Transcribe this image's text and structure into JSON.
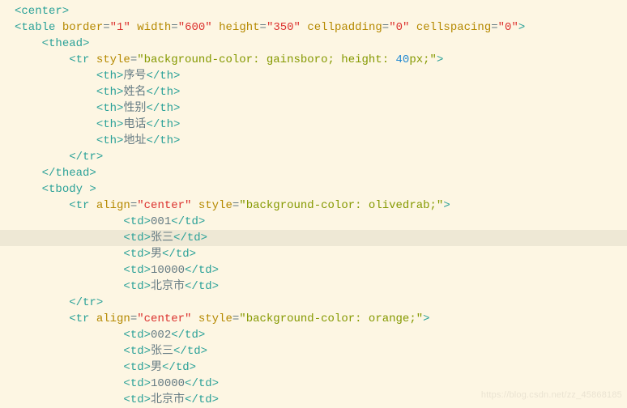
{
  "watermark": "https://blog.csdn.net/zz_45868185",
  "code_lines": [
    {
      "i": 0,
      "hl": false,
      "tokens": [
        {
          "t": "<center>",
          "c": "tag"
        }
      ]
    },
    {
      "i": 0,
      "hl": false,
      "tokens": [
        {
          "t": "<table ",
          "c": "tag"
        },
        {
          "t": "border",
          "c": "attr"
        },
        {
          "t": "=",
          "c": "text"
        },
        {
          "t": "\"1\"",
          "c": "val-red"
        },
        {
          "t": " ",
          "c": "text"
        },
        {
          "t": "width",
          "c": "attr"
        },
        {
          "t": "=",
          "c": "text"
        },
        {
          "t": "\"600\"",
          "c": "val-red"
        },
        {
          "t": " ",
          "c": "text"
        },
        {
          "t": "height",
          "c": "attr"
        },
        {
          "t": "=",
          "c": "text"
        },
        {
          "t": "\"350\"",
          "c": "val-red"
        },
        {
          "t": " ",
          "c": "text"
        },
        {
          "t": "cellpadding",
          "c": "attr"
        },
        {
          "t": "=",
          "c": "text"
        },
        {
          "t": "\"0\"",
          "c": "val-red"
        },
        {
          "t": " ",
          "c": "text"
        },
        {
          "t": "cellspacing",
          "c": "attr"
        },
        {
          "t": "=",
          "c": "text"
        },
        {
          "t": "\"0\"",
          "c": "val-red"
        },
        {
          "t": ">",
          "c": "tag"
        }
      ]
    },
    {
      "i": 4,
      "hl": false,
      "tokens": [
        {
          "t": "<thead>",
          "c": "tag"
        }
      ]
    },
    {
      "i": 8,
      "hl": false,
      "tokens": [
        {
          "t": "<tr ",
          "c": "tag"
        },
        {
          "t": "style",
          "c": "attr"
        },
        {
          "t": "=",
          "c": "text"
        },
        {
          "t": "\"background-color: gainsboro; height: ",
          "c": "val-olive"
        },
        {
          "t": "40",
          "c": "val-blue"
        },
        {
          "t": "px;\"",
          "c": "val-olive"
        },
        {
          "t": ">",
          "c": "tag"
        }
      ]
    },
    {
      "i": 12,
      "hl": false,
      "tokens": [
        {
          "t": "<th>",
          "c": "tag"
        },
        {
          "t": "序号",
          "c": "text"
        },
        {
          "t": "</th>",
          "c": "tag"
        }
      ]
    },
    {
      "i": 12,
      "hl": false,
      "tokens": [
        {
          "t": "<th>",
          "c": "tag"
        },
        {
          "t": "姓名",
          "c": "text"
        },
        {
          "t": "</th>",
          "c": "tag"
        }
      ]
    },
    {
      "i": 12,
      "hl": false,
      "tokens": [
        {
          "t": "<th>",
          "c": "tag"
        },
        {
          "t": "性别",
          "c": "text"
        },
        {
          "t": "</th>",
          "c": "tag"
        }
      ]
    },
    {
      "i": 12,
      "hl": false,
      "tokens": [
        {
          "t": "<th>",
          "c": "tag"
        },
        {
          "t": "电话",
          "c": "text"
        },
        {
          "t": "</th>",
          "c": "tag"
        }
      ]
    },
    {
      "i": 12,
      "hl": false,
      "tokens": [
        {
          "t": "<th>",
          "c": "tag"
        },
        {
          "t": "地址",
          "c": "text"
        },
        {
          "t": "</th>",
          "c": "tag"
        }
      ]
    },
    {
      "i": 8,
      "hl": false,
      "tokens": [
        {
          "t": "</tr>",
          "c": "tag"
        }
      ]
    },
    {
      "i": 4,
      "hl": false,
      "tokens": [
        {
          "t": "</thead>",
          "c": "tag"
        }
      ]
    },
    {
      "i": 4,
      "hl": false,
      "tokens": [
        {
          "t": "<tbody ",
          "c": "tag"
        },
        {
          "t": ">",
          "c": "tag"
        }
      ]
    },
    {
      "i": 8,
      "hl": false,
      "tokens": [
        {
          "t": "<tr ",
          "c": "tag"
        },
        {
          "t": "align",
          "c": "attr"
        },
        {
          "t": "=",
          "c": "text"
        },
        {
          "t": "\"center\"",
          "c": "val-red"
        },
        {
          "t": " ",
          "c": "text"
        },
        {
          "t": "style",
          "c": "attr"
        },
        {
          "t": "=",
          "c": "text"
        },
        {
          "t": "\"background-color: olivedrab;\"",
          "c": "val-olive"
        },
        {
          "t": ">",
          "c": "tag"
        }
      ]
    },
    {
      "i": 16,
      "hl": false,
      "tokens": [
        {
          "t": "<td>",
          "c": "tag"
        },
        {
          "t": "001",
          "c": "text"
        },
        {
          "t": "</td>",
          "c": "tag"
        }
      ]
    },
    {
      "i": 16,
      "hl": true,
      "tokens": [
        {
          "t": "<td>",
          "c": "tag"
        },
        {
          "t": "张三",
          "c": "text"
        },
        {
          "t": "<",
          "c": "tag"
        },
        {
          "t": "/td>",
          "c": "tag"
        }
      ]
    },
    {
      "i": 16,
      "hl": false,
      "tokens": [
        {
          "t": "<td>",
          "c": "tag"
        },
        {
          "t": "男",
          "c": "text"
        },
        {
          "t": "</td>",
          "c": "tag"
        }
      ]
    },
    {
      "i": 16,
      "hl": false,
      "tokens": [
        {
          "t": "<td>",
          "c": "tag"
        },
        {
          "t": "10000",
          "c": "text"
        },
        {
          "t": "</td>",
          "c": "tag"
        }
      ]
    },
    {
      "i": 16,
      "hl": false,
      "tokens": [
        {
          "t": "<td>",
          "c": "tag"
        },
        {
          "t": "北京市",
          "c": "text"
        },
        {
          "t": "</td>",
          "c": "tag"
        }
      ]
    },
    {
      "i": 8,
      "hl": false,
      "tokens": [
        {
          "t": "</tr>",
          "c": "tag"
        }
      ]
    },
    {
      "i": 8,
      "hl": false,
      "tokens": [
        {
          "t": "<tr ",
          "c": "tag"
        },
        {
          "t": "align",
          "c": "attr"
        },
        {
          "t": "=",
          "c": "text"
        },
        {
          "t": "\"center\"",
          "c": "val-red"
        },
        {
          "t": " ",
          "c": "text"
        },
        {
          "t": "style",
          "c": "attr"
        },
        {
          "t": "=",
          "c": "text"
        },
        {
          "t": "\"background-color: orange;\"",
          "c": "val-olive"
        },
        {
          "t": ">",
          "c": "tag"
        }
      ]
    },
    {
      "i": 16,
      "hl": false,
      "tokens": [
        {
          "t": "<td>",
          "c": "tag"
        },
        {
          "t": "002",
          "c": "text"
        },
        {
          "t": "</td>",
          "c": "tag"
        }
      ]
    },
    {
      "i": 16,
      "hl": false,
      "tokens": [
        {
          "t": "<td>",
          "c": "tag"
        },
        {
          "t": "张三",
          "c": "text"
        },
        {
          "t": "</td>",
          "c": "tag"
        }
      ]
    },
    {
      "i": 16,
      "hl": false,
      "tokens": [
        {
          "t": "<td>",
          "c": "tag"
        },
        {
          "t": "男",
          "c": "text"
        },
        {
          "t": "</td>",
          "c": "tag"
        }
      ]
    },
    {
      "i": 16,
      "hl": false,
      "tokens": [
        {
          "t": "<td>",
          "c": "tag"
        },
        {
          "t": "10000",
          "c": "text"
        },
        {
          "t": "</td>",
          "c": "tag"
        }
      ]
    },
    {
      "i": 16,
      "hl": false,
      "tokens": [
        {
          "t": "<td>",
          "c": "tag"
        },
        {
          "t": "北京市",
          "c": "text"
        },
        {
          "t": "</td>",
          "c": "tag"
        }
      ]
    }
  ]
}
